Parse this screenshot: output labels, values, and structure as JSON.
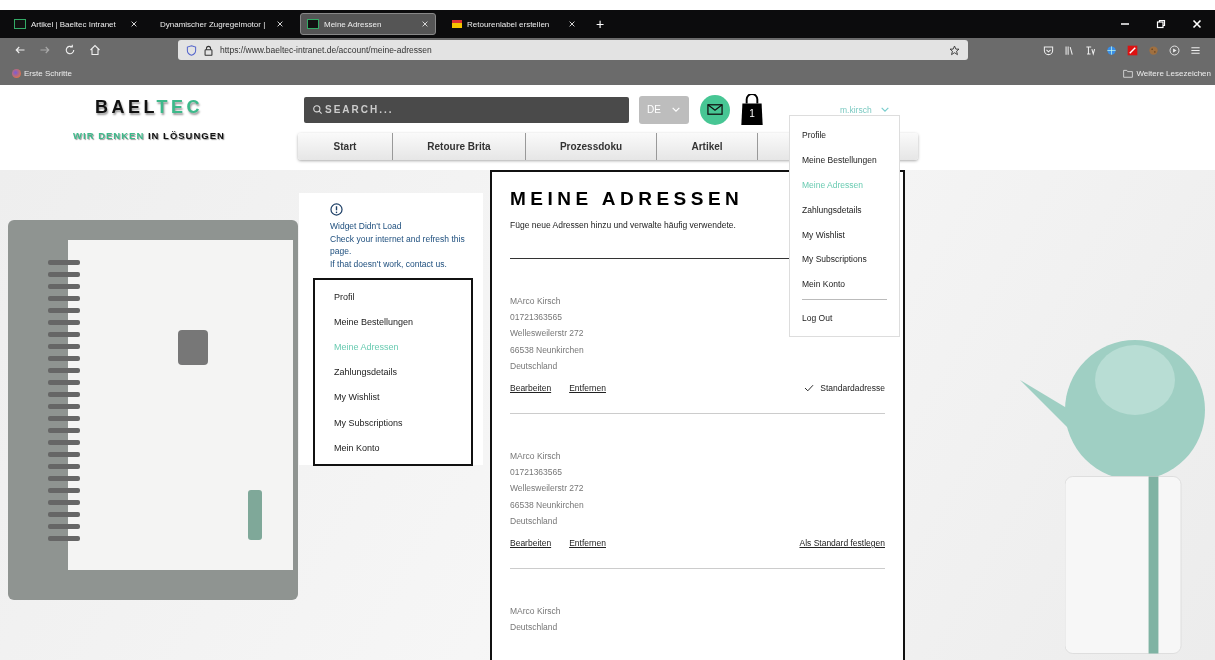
{
  "browser": {
    "tabs": [
      {
        "title": "Artikel | Baeltec Intranet",
        "kind": "site",
        "selected": false
      },
      {
        "title": "Dynamischer Zugregelmotor |",
        "kind": "none",
        "selected": false
      },
      {
        "title": "Meine Adressen",
        "kind": "site",
        "selected": true
      },
      {
        "title": "Retourenlabel erstellen",
        "kind": "label",
        "selected": false
      }
    ],
    "new_tab": "+",
    "url": "https://www.baeltec-intranet.de/account/meine-adressen",
    "bookmarks": [
      "Erste Schritte"
    ],
    "other_bookmarks": "Weitere Lesezeichen"
  },
  "header": {
    "logo": [
      {
        "text": "BAEL",
        "color": "#111111"
      },
      {
        "text": "TEC",
        "color": "#3cb98a"
      }
    ],
    "tagline": [
      {
        "text": "WIR DENKEN",
        "color": "#3cb98a"
      },
      {
        "text": "IN LÖSUNGEN",
        "color": "#111111"
      }
    ],
    "search": {
      "placeholder": "SEARCH..."
    },
    "language": "DE",
    "cart_count": "1",
    "user": "m.kirsch",
    "nav": [
      "Start",
      "Retoure Brita",
      "Prozessdoku",
      "Artikel"
    ]
  },
  "user_menu": {
    "items": [
      {
        "label": "Profile",
        "selected": false
      },
      {
        "label": "Meine Bestellungen",
        "selected": false
      },
      {
        "label": "Meine Adressen",
        "selected": true
      },
      {
        "label": "Zahlungsdetails",
        "selected": false
      },
      {
        "label": "My Wishlist",
        "selected": false
      },
      {
        "label": "My Subscriptions",
        "selected": false
      },
      {
        "label": "Mein Konto",
        "selected": false
      }
    ],
    "logout": "Log Out"
  },
  "widget_error": {
    "lines": [
      "Widget Didn't Load",
      "Check your internet and refresh this page.",
      "If that doesn't work, contact us."
    ]
  },
  "account_menu": [
    {
      "label": "Profil",
      "selected": false
    },
    {
      "label": "Meine Bestellungen",
      "selected": false
    },
    {
      "label": "Meine Adressen",
      "selected": true
    },
    {
      "label": "Zahlungsdetails",
      "selected": false
    },
    {
      "label": "My Wishlist",
      "selected": false
    },
    {
      "label": "My Subscriptions",
      "selected": false
    },
    {
      "label": "Mein Konto",
      "selected": false
    }
  ],
  "main": {
    "title": "MEINE ADRESSEN",
    "subtitle": "Füge neue Adressen hinzu und verwalte häufig verwendete.",
    "addresses": [
      {
        "lines": [
          "MArco Kirsch",
          "01721363565",
          "Wellesweilerstr 272",
          "66538 Neunkirchen",
          "Deutschland"
        ],
        "edit": "Bearbeiten",
        "remove": "Entfernen",
        "is_default": true,
        "default_label": "Standardadresse"
      },
      {
        "lines": [
          "MArco Kirsch",
          "01721363565",
          "Wellesweilerstr 272",
          "66538 Neunkirchen",
          "Deutschland"
        ],
        "edit": "Bearbeiten",
        "remove": "Entfernen",
        "is_default": false,
        "default_label": "Als Standard festlegen"
      },
      {
        "lines": [
          "MArco Kirsch",
          "Deutschland"
        ]
      }
    ]
  }
}
